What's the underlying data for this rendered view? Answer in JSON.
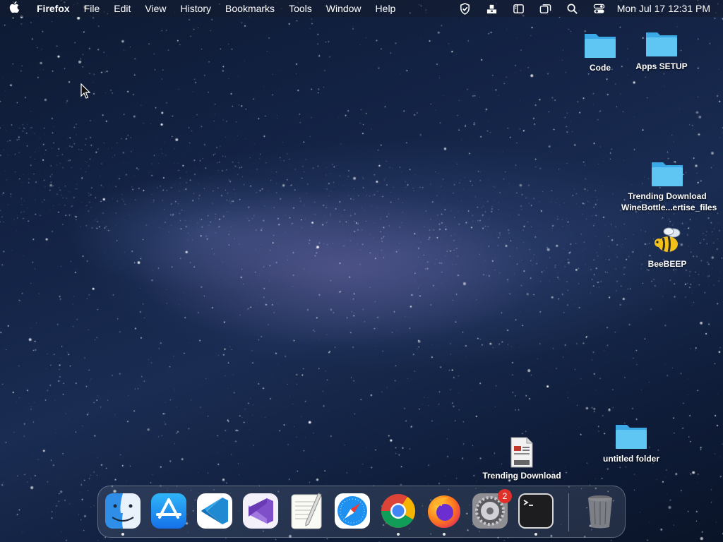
{
  "menubar": {
    "apple_icon": "apple-logo-icon",
    "app_name": "Firefox",
    "menus": [
      "File",
      "Edit",
      "View",
      "History",
      "Bookmarks",
      "Tools",
      "Window",
      "Help"
    ],
    "status_icons": [
      "vpn-shield-icon",
      "upload-tray-icon",
      "sidebar-icon",
      "windows-icon",
      "search-icon",
      "control-center-icon"
    ],
    "clock": "Mon Jul 17  12:31 PM"
  },
  "desktop": {
    "icons": [
      {
        "label": "Code",
        "icon": "folder-icon"
      },
      {
        "label": "Apps SETUP",
        "icon": "folder-icon"
      },
      {
        "label": "Trending Download",
        "label2": "WineBottle...ertise_files",
        "icon": "folder-icon"
      },
      {
        "label": "BeeBEEP",
        "icon": "bee-app-icon"
      },
      {
        "label": "untitled folder",
        "icon": "folder-icon"
      },
      {
        "label": "Trending Download",
        "icon": "html-file-icon"
      }
    ]
  },
  "dock": {
    "apps": [
      {
        "name": "Finder",
        "icon": "finder-icon",
        "running": true
      },
      {
        "name": "App Store",
        "icon": "app-store-icon",
        "running": false
      },
      {
        "name": "Visual Studio Code",
        "icon": "vscode-icon",
        "running": false
      },
      {
        "name": "Visual Studio",
        "icon": "visual-studio-icon",
        "running": false
      },
      {
        "name": "TextEdit",
        "icon": "textedit-icon",
        "running": false
      },
      {
        "name": "Safari",
        "icon": "safari-icon",
        "running": false
      },
      {
        "name": "Google Chrome",
        "icon": "chrome-icon",
        "running": true
      },
      {
        "name": "Firefox",
        "icon": "firefox-icon",
        "running": true
      },
      {
        "name": "System Settings",
        "icon": "settings-icon",
        "running": false,
        "badge": "2"
      },
      {
        "name": "Terminal",
        "icon": "terminal-icon",
        "running": true
      },
      {
        "name": "Trash",
        "icon": "trash-icon",
        "running": false
      }
    ]
  },
  "colors": {
    "folder": "#5fc6f3",
    "badge": "#e0302a",
    "menubar_text": "#ffffff"
  }
}
